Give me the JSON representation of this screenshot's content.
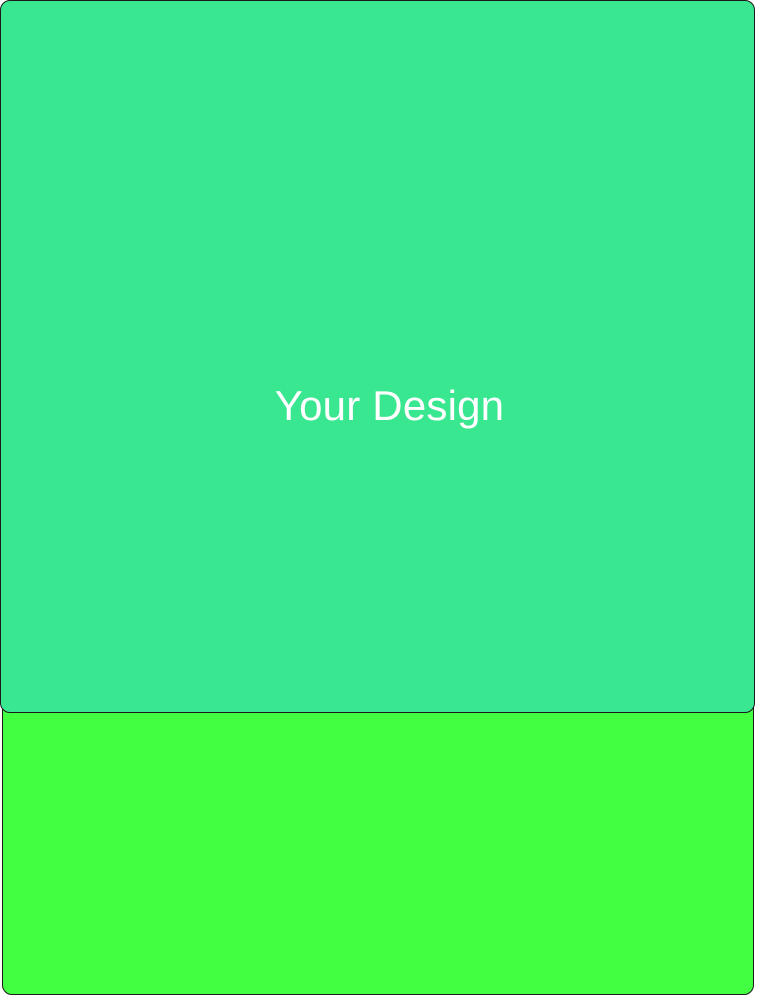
{
  "design_area": {
    "label": "Your Design",
    "color": "#38e78f"
  },
  "base_area": {
    "color": "#42ff42"
  },
  "text_color": "#ffffff",
  "outline_color": "#1a1a1a"
}
